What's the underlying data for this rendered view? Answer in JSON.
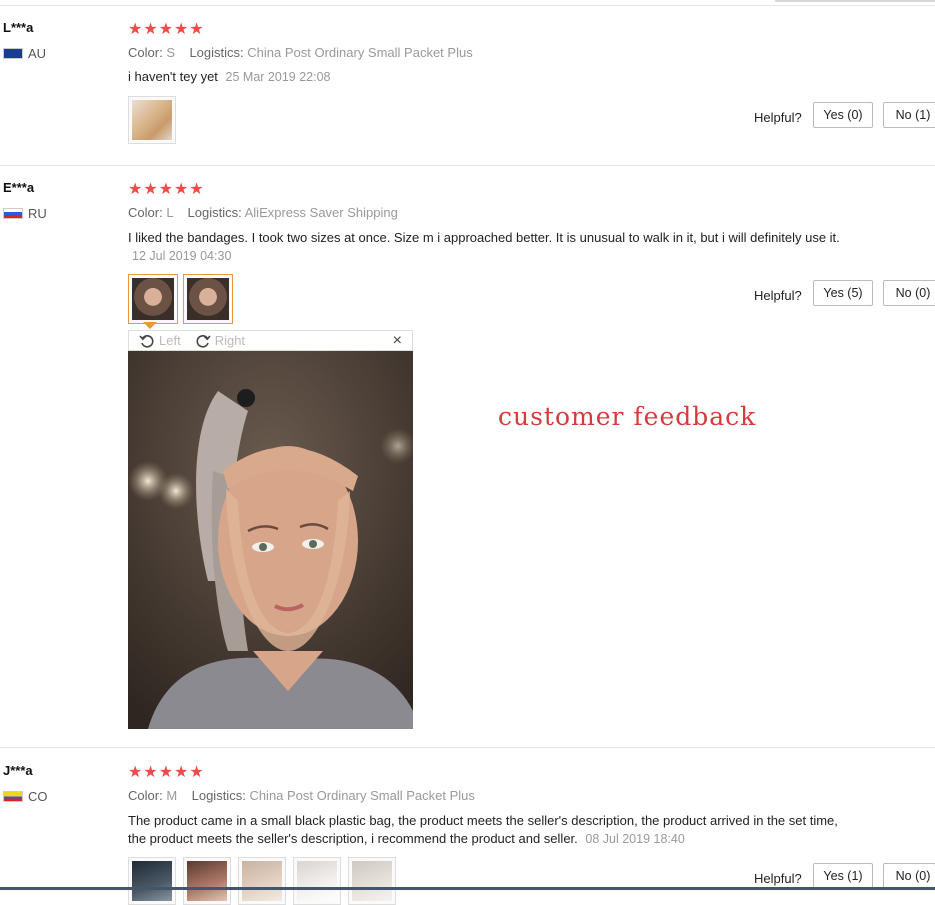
{
  "reviews": [
    {
      "user": "L***a",
      "country": "AU",
      "stars": "★★★★★",
      "color_label": "Color:",
      "color_value": "S",
      "logistics_label": "Logistics:",
      "logistics_value": "China Post Ordinary Small Packet Plus",
      "text": "i haven't tey yet",
      "date": "25 Mar 2019 22:08",
      "helpful_label": "Helpful?",
      "yes_label": "Yes (0)",
      "no_label": "No (1)"
    },
    {
      "user": "E***a",
      "country": "RU",
      "stars": "★★★★★",
      "color_label": "Color:",
      "color_value": "L",
      "logistics_label": "Logistics:",
      "logistics_value": "AliExpress Saver Shipping",
      "text": "I liked the bandages. I took two sizes at once. Size m i approached better. It is unusual to walk in it, but i will definitely use it.",
      "date": "12 Jul 2019 04:30",
      "helpful_label": "Helpful?",
      "yes_label": "Yes (5)",
      "no_label": "No (0)"
    },
    {
      "user": "J***a",
      "country": "CO",
      "stars": "★★★★★",
      "color_label": "Color:",
      "color_value": "M",
      "logistics_label": "Logistics:",
      "logistics_value": "China Post Ordinary Small Packet Plus",
      "text": "The product came in a small black plastic bag, the product meets the seller's description, the product arrived in the set time, the product meets the seller's description, i recommend the product and seller.",
      "date": "08 Jul 2019 18:40",
      "helpful_label": "Helpful?",
      "yes_label": "Yes (1)",
      "no_label": "No (0)"
    }
  ],
  "viewer": {
    "rotate_left": "Left",
    "rotate_right": "Right",
    "close": "×"
  },
  "overlay_text": "customer feedback",
  "colors": {
    "star": "#f04b4b",
    "active_thumb": "#e69a3a",
    "overlay": "#d33c3c"
  }
}
